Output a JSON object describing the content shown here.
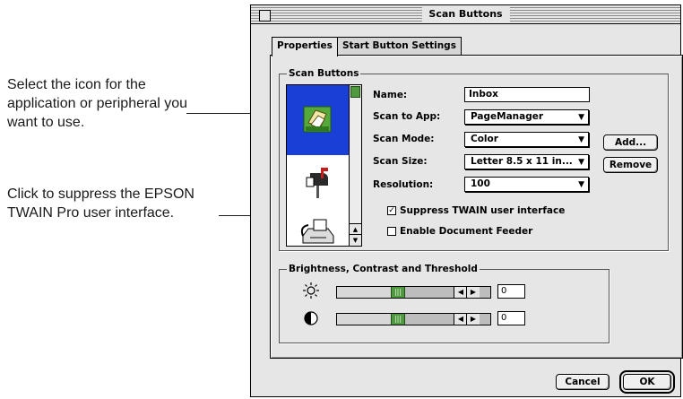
{
  "callouts": {
    "icon_hint": "Select the icon for the application or peripheral you want to use.",
    "twain_hint": "Click to suppress the EPSON TWAIN Pro user interface."
  },
  "window": {
    "title": "Scan Buttons"
  },
  "tabs": [
    {
      "label": "Properties",
      "active": true
    },
    {
      "label": "Start Button Settings",
      "active": false
    }
  ],
  "scan_buttons_group": {
    "title": "Scan Buttons",
    "icons": [
      {
        "name": "page-manager-icon",
        "selected": true
      },
      {
        "name": "mailbox-icon",
        "selected": false
      },
      {
        "name": "fax-icon",
        "selected": false
      }
    ],
    "fields": {
      "name": {
        "label": "Name:",
        "value": "Inbox"
      },
      "scan_to_app": {
        "label": "Scan to App:",
        "value": "PageManager"
      },
      "scan_mode": {
        "label": "Scan Mode:",
        "value": "Color"
      },
      "scan_size": {
        "label": "Scan Size:",
        "value": "Letter 8.5 x 11 in..."
      },
      "resolution": {
        "label": "Resolution:",
        "value": "100"
      }
    },
    "checkboxes": {
      "suppress_twain": {
        "label": "Suppress TWAIN user interface",
        "checked": true
      },
      "document_feeder": {
        "label": "Enable Document Feeder",
        "checked": false
      }
    },
    "buttons": {
      "add": "Add...",
      "remove": "Remove"
    }
  },
  "brightness_group": {
    "title": "Brightness, Contrast and Threshold",
    "brightness": {
      "icon": "sun-icon",
      "value": "0"
    },
    "contrast": {
      "icon": "half-circle-icon",
      "value": "0"
    }
  },
  "footer": {
    "cancel": "Cancel",
    "ok": "OK"
  }
}
